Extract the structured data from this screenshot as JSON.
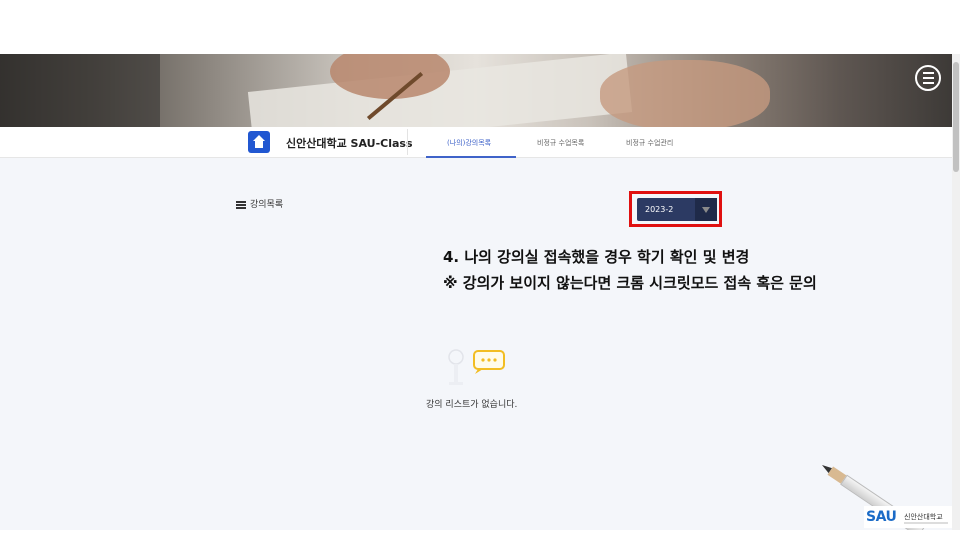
{
  "header": {
    "menu_icon": "hamburger-circle-icon"
  },
  "nav": {
    "site_title": "신안산대학교 SAU-Class",
    "home_icon": "home-icon",
    "tabs": [
      {
        "label": "(나의)강의목록",
        "active": true
      },
      {
        "label": "비정규 수업목록",
        "active": false
      },
      {
        "label": "비정규 수업관리",
        "active": false
      }
    ],
    "accent_color": "#3f63c9"
  },
  "main": {
    "list_heading": "강의목록",
    "list_icon": "list-icon",
    "semester_select": {
      "value": "2023-2",
      "highlight_color": "#e01010"
    },
    "annotation": {
      "line1": "4. 나의 강의실 접속했을 경우 학기 확인 및 변경",
      "line2": "※ 강의가 보이지 않는다면 크롬 시크릿모드 접속 혹은 문의"
    },
    "empty_state": {
      "icon": "chat-bubble-icon",
      "message": "강의 리스트가 없습니다."
    }
  },
  "brand": {
    "logo_text": "SAU",
    "name": "신안산대학교"
  }
}
